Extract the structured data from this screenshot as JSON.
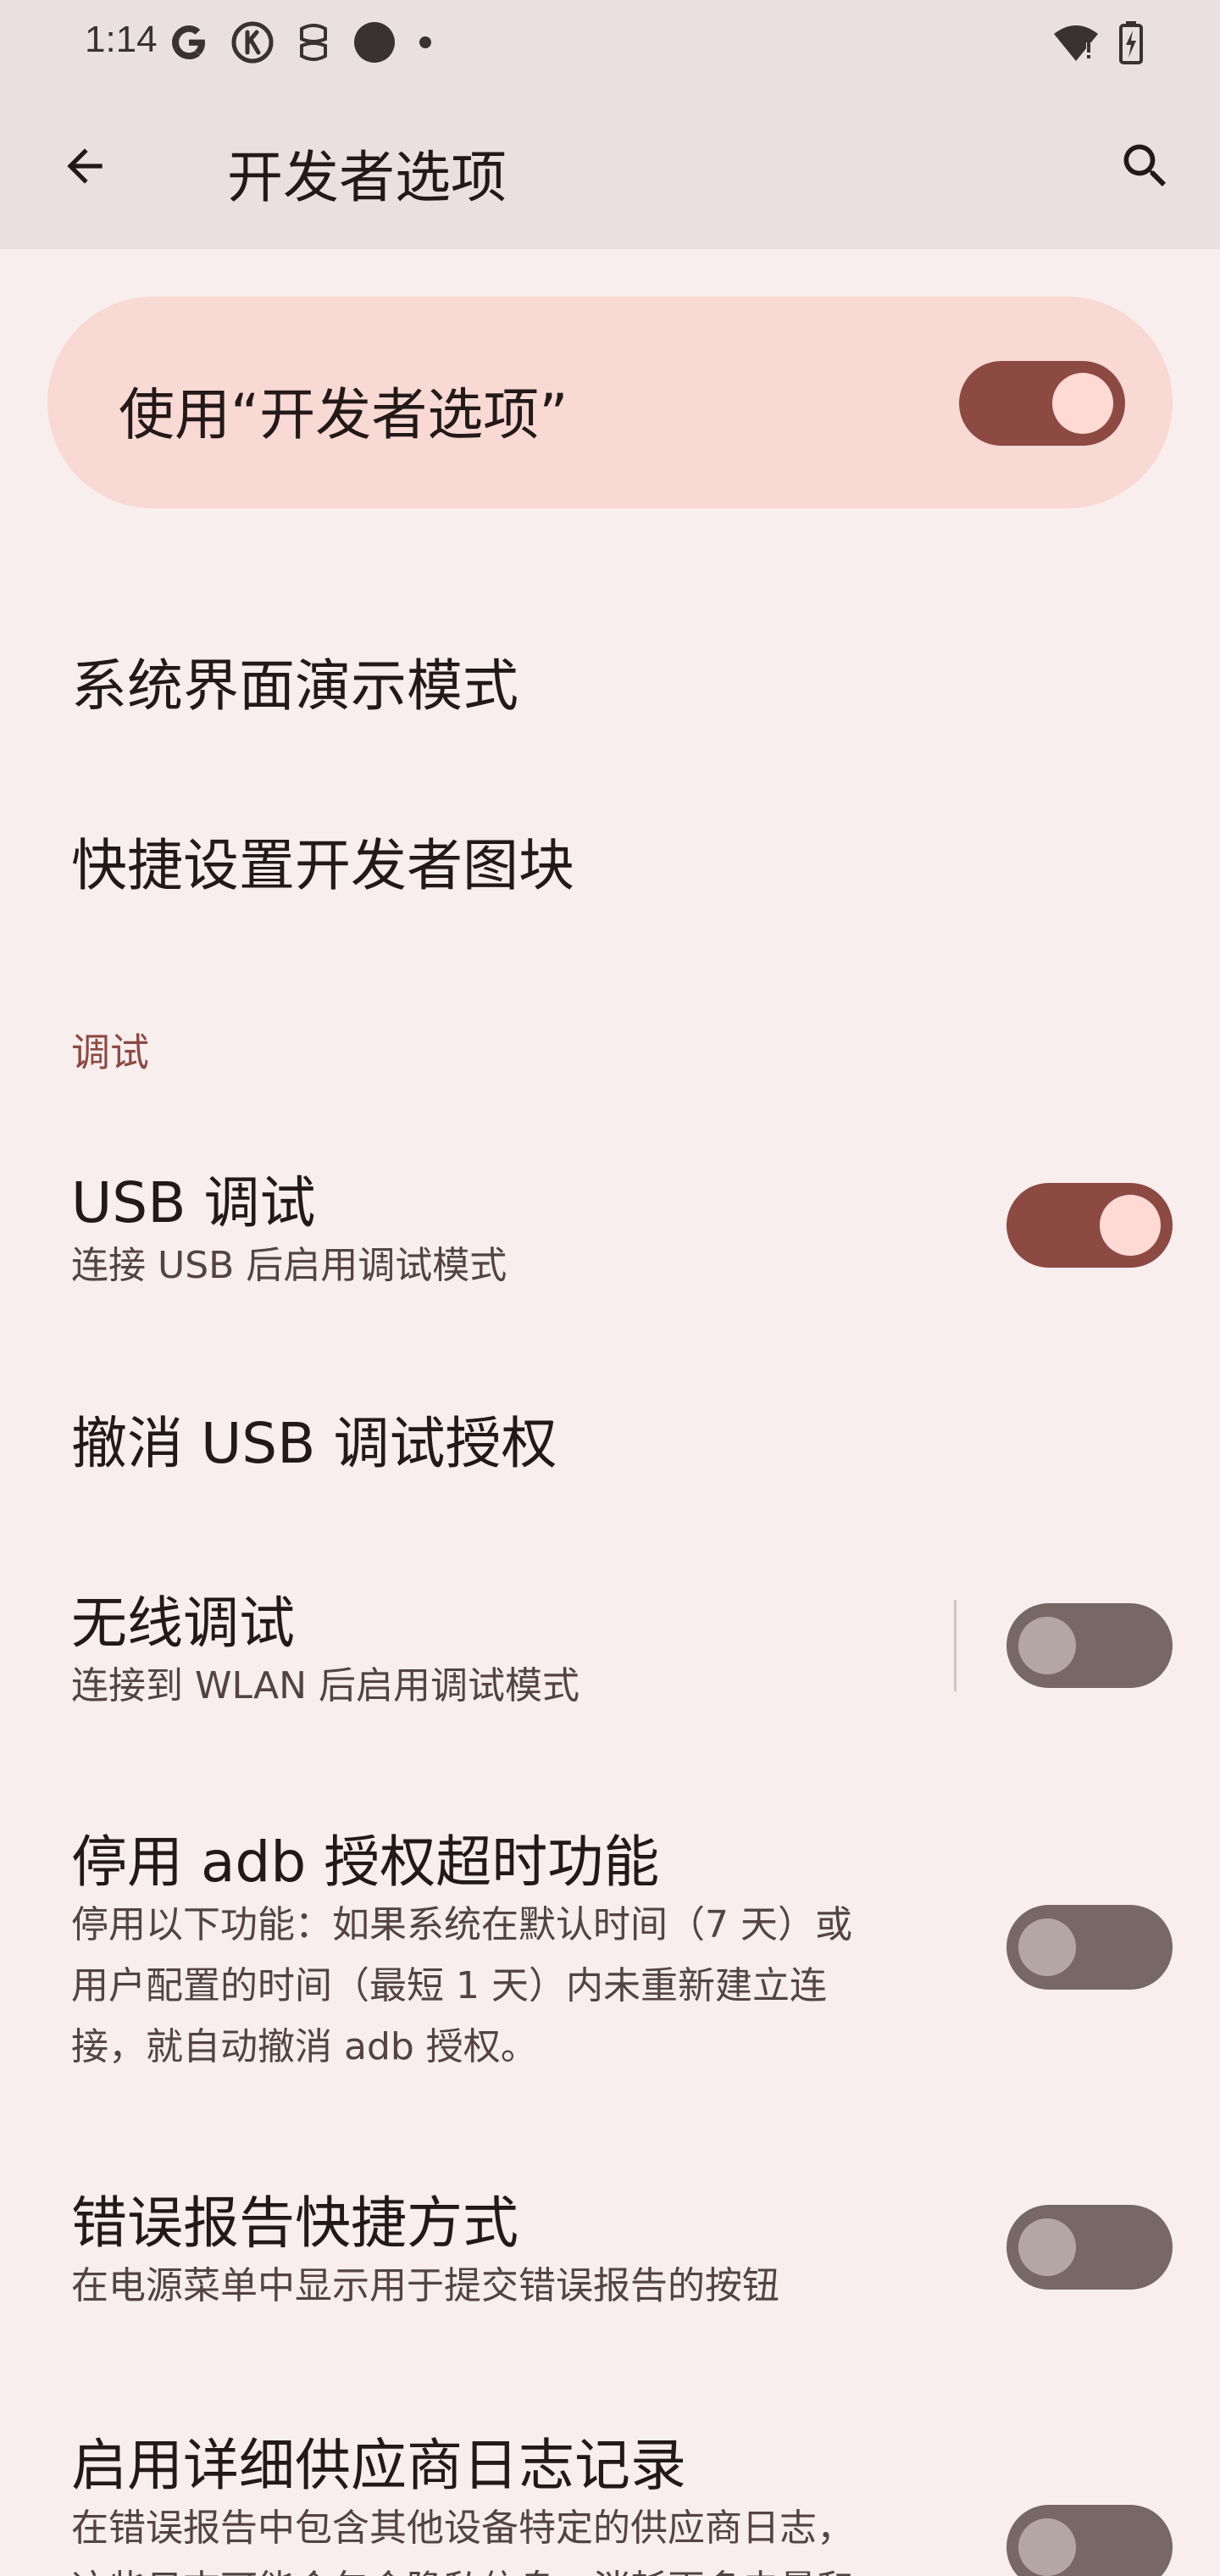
{
  "status_bar": {
    "time": "1:14",
    "left_icons": [
      "google-icon",
      "k-app-icon",
      "ai-app-icon",
      "dark-circle-icon",
      "dot-icon"
    ],
    "right_icons": [
      "wifi-alert-icon",
      "battery-charging-icon"
    ]
  },
  "app_bar": {
    "title": "开发者选项",
    "back_icon": "arrow-back-icon",
    "search_icon": "search-icon"
  },
  "master_switch": {
    "label": "使用“开发者选项”",
    "checked": true
  },
  "items": {
    "system_ui_demo": "系统界面演示模式",
    "quick_tiles": "快捷设置开发者图块"
  },
  "section_debug": {
    "header": "调试",
    "usb_debug": {
      "title": "USB 调试",
      "summary": "连接 USB 后启用调试模式",
      "checked": true
    },
    "revoke_usb": {
      "title": "撤消 USB 调试授权"
    },
    "wireless_debug": {
      "title": "无线调试",
      "summary": "连接到 WLAN 后启用调试模式",
      "checked": false
    },
    "adb_timeout": {
      "title": "停用 adb 授权超时功能",
      "summary_lines": [
        "停用以下功能：如果系统在默认时间（7 天）或",
        "用户配置的时间（最短 1 天）内未重新建立连",
        "接，就自动撤消 adb 授权。"
      ],
      "checked": false
    },
    "bugreport_shortcut": {
      "title": "错误报告快捷方式",
      "summary": "在电源菜单中显示用于提交错误报告的按钮",
      "checked": false
    },
    "vendor_logging": {
      "title": "启用详细供应商日志记录",
      "summary_lines": [
        "在错误报告中包含其他设备特定的供应商日志，",
        "这些日志可能会包含隐私信息、消耗更多电量和"
      ],
      "checked": false
    }
  },
  "colors": {
    "accent": "#8c4a42",
    "background": "#f8eeee",
    "appbar": "#ebe0e0",
    "card": "#f9d9d3"
  }
}
